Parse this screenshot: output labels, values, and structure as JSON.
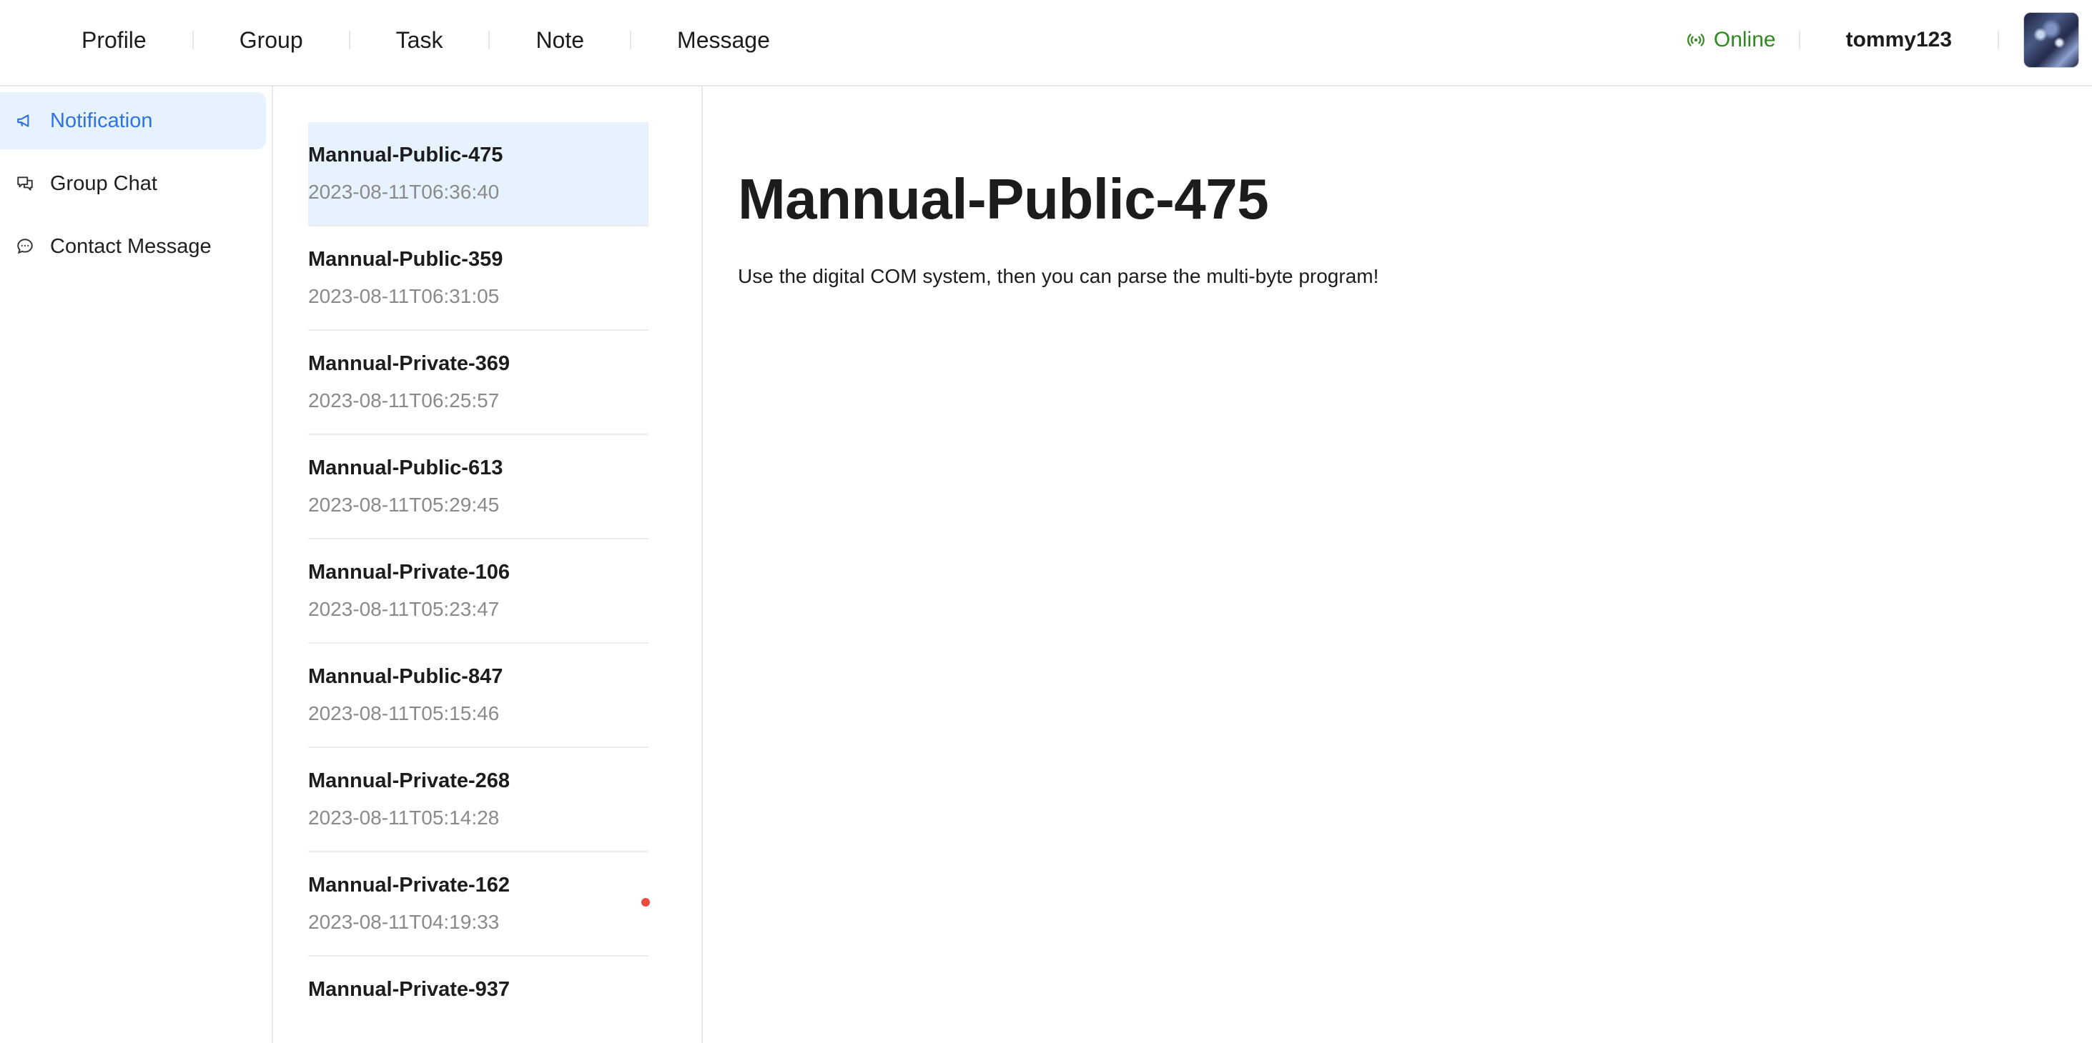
{
  "nav": {
    "items": [
      "Profile",
      "Group",
      "Task",
      "Note",
      "Message"
    ]
  },
  "header": {
    "status_label": "Online",
    "status_icon": "broadcast-icon",
    "username": "tommy123"
  },
  "sidebar": {
    "items": [
      {
        "label": "Notification",
        "icon": "megaphone-icon",
        "active": true
      },
      {
        "label": "Group Chat",
        "icon": "chat-bubbles-icon",
        "active": false
      },
      {
        "label": "Contact Message",
        "icon": "message-dots-icon",
        "active": false
      }
    ]
  },
  "messages": [
    {
      "title": "Mannual-Public-475",
      "time": "2023-08-11T06:36:40",
      "selected": true,
      "unread": false
    },
    {
      "title": "Mannual-Public-359",
      "time": "2023-08-11T06:31:05",
      "selected": false,
      "unread": false
    },
    {
      "title": "Mannual-Private-369",
      "time": "2023-08-11T06:25:57",
      "selected": false,
      "unread": false
    },
    {
      "title": "Mannual-Public-613",
      "time": "2023-08-11T05:29:45",
      "selected": false,
      "unread": false
    },
    {
      "title": "Mannual-Private-106",
      "time": "2023-08-11T05:23:47",
      "selected": false,
      "unread": false
    },
    {
      "title": "Mannual-Public-847",
      "time": "2023-08-11T05:15:46",
      "selected": false,
      "unread": false
    },
    {
      "title": "Mannual-Private-268",
      "time": "2023-08-11T05:14:28",
      "selected": false,
      "unread": false
    },
    {
      "title": "Mannual-Private-162",
      "time": "2023-08-11T04:19:33",
      "selected": false,
      "unread": true
    },
    {
      "title": "Mannual-Private-937",
      "time": "",
      "selected": false,
      "unread": false
    }
  ],
  "detail": {
    "title": "Mannual-Public-475",
    "body": "Use the digital COM system, then you can parse the multi-byte program!"
  },
  "colors": {
    "accent": "#2f72e0",
    "selected_bg": "#e6f3ff",
    "online": "#2e8a1e",
    "unread_dot": "#ee4b40"
  }
}
